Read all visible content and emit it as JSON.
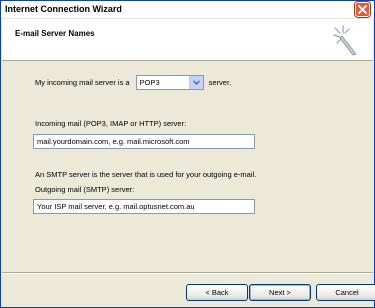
{
  "window": {
    "title": "Internet Connection Wizard"
  },
  "header": {
    "title": "E-mail Server Names"
  },
  "form": {
    "incoming_prefix": "My incoming mail server is a",
    "server_type": "POP3",
    "incoming_suffix": "server.",
    "incoming_label": "Incoming mail (POP3, IMAP or HTTP) server:",
    "incoming_value": "mail.yourdomain.com, e.g. mail.microsoft.com",
    "smtp_note": "An SMTP server is the server that is used for your outgoing e-mail.",
    "outgoing_label": "Outgoing mail (SMTP) server:",
    "outgoing_value": "Your ISP mail server, e.g. mail.optusnet.com.au"
  },
  "buttons": {
    "back": "< Back",
    "next": "Next >",
    "cancel": "Cancel"
  },
  "colors": {
    "dialog_face": "#ece9d8",
    "close_button": "#e35a36",
    "input_border": "#7f9db9"
  }
}
